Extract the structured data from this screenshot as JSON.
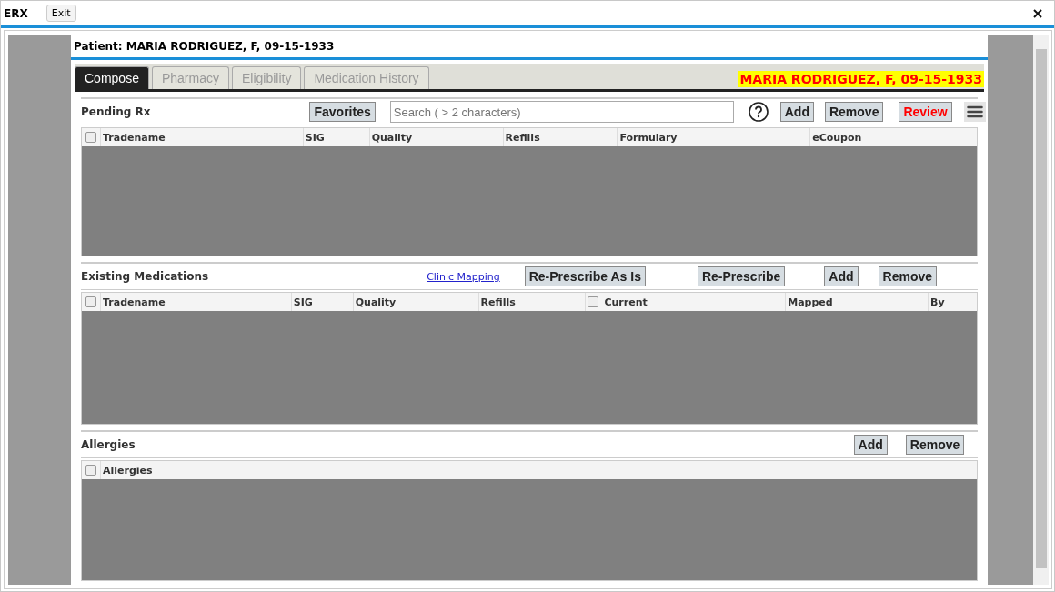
{
  "window": {
    "title": "ERX",
    "exit": "Exit"
  },
  "patient_header": "Patient: MARIA RODRIGUEZ, F, 09-15-1933",
  "tabs": [
    {
      "label": "Compose",
      "selected": true
    },
    {
      "label": "Pharmacy",
      "selected": false
    },
    {
      "label": "Eligibility",
      "selected": false
    },
    {
      "label": "Medication History",
      "selected": false
    }
  ],
  "patient_banner": "MARIA RODRIGUEZ, F, 09-15-1933",
  "sections": [
    {
      "title": "Pending Rx",
      "tools": [
        {
          "kind": "button",
          "label": "Favorites"
        },
        {
          "kind": "search",
          "placeholder": "Search ( > 2 characters)"
        },
        {
          "kind": "help"
        },
        {
          "kind": "button",
          "label": "Add"
        },
        {
          "kind": "button",
          "label": "Remove"
        },
        {
          "kind": "alert",
          "label": "Review"
        },
        {
          "kind": "menu"
        }
      ],
      "select_all": {
        "checked": false
      },
      "columns": [
        {
          "label": "Tradename"
        },
        {
          "label": "SIG"
        },
        {
          "label": "Quality"
        },
        {
          "label": "Refills"
        },
        {
          "label": "Formulary"
        },
        {
          "label": "eCoupon"
        }
      ]
    },
    {
      "title": "Existing Medications",
      "tools": [
        {
          "kind": "link",
          "label": "Clinic Mapping"
        },
        {
          "kind": "button",
          "label": "Re-Prescribe As Is"
        },
        {
          "kind": "button",
          "label": "Re-Prescribe"
        },
        {
          "kind": "button",
          "label": "Add"
        },
        {
          "kind": "button",
          "label": "Remove"
        }
      ],
      "select_all": {
        "checked": false
      },
      "columns": [
        {
          "label": "Tradename"
        },
        {
          "label": "SIG"
        },
        {
          "label": "Quality"
        },
        {
          "label": "Refills"
        },
        {
          "label": "Current",
          "checked": false
        },
        {
          "label": "Mapped"
        },
        {
          "label": "By"
        }
      ]
    },
    {
      "title": "Allergies",
      "tools": [
        {
          "kind": "button",
          "label": "Add"
        },
        {
          "kind": "button",
          "label": "Remove"
        }
      ],
      "select_all": {
        "checked": false
      },
      "columns": [
        {
          "label": "Allergies"
        }
      ]
    }
  ]
}
